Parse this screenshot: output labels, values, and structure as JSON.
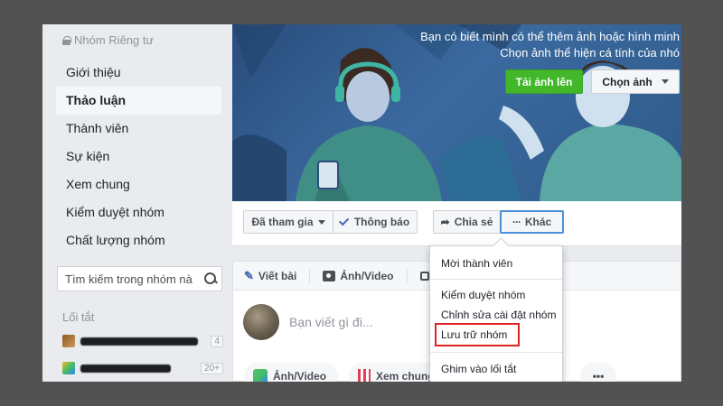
{
  "sidebar": {
    "privacy_label": "Nhóm Riêng tư",
    "items": [
      {
        "label": "Giới thiệu"
      },
      {
        "label": "Thảo luận"
      },
      {
        "label": "Thành viên"
      },
      {
        "label": "Sự kiện"
      },
      {
        "label": "Xem chung"
      },
      {
        "label": "Kiểm duyệt nhóm"
      },
      {
        "label": "Chất lượng nhóm"
      }
    ],
    "search_placeholder": "Tìm kiếm trong nhóm nà",
    "shortcuts_title": "Lối tắt",
    "shortcuts": [
      {
        "badge": "4"
      },
      {
        "badge": "20+"
      }
    ]
  },
  "cover": {
    "line1": "Bạn có biết mình có thể thêm ảnh hoặc hình minh",
    "line2": "Chọn ảnh thể hiện cá tính của nhó",
    "upload_label": "Tải ảnh lên",
    "choose_label": "Chọn ảnh"
  },
  "actions": {
    "joined": "Đã tham gia",
    "notify": "Thông báo",
    "share": "Chia sẻ",
    "more": "Khác"
  },
  "composer": {
    "write_tab": "Viết bài",
    "photo_tab": "Ảnh/Video",
    "placeholder": "Bạn viết gì đi...",
    "photo_pill": "Ảnh/Video",
    "watch_pill": "Xem chung",
    "more_pill": "•••"
  },
  "menu": {
    "items": [
      "Mời thành viên",
      "Kiểm duyệt nhóm",
      "Chỉnh sửa cài đặt nhóm",
      "Lưu trữ nhóm",
      "Ghim vào lối tắt"
    ],
    "highlight_color": "#e02424"
  },
  "colors": {
    "brand_blue": "#4267b2",
    "green": "#42b72a",
    "cover": "#3b6aa0"
  }
}
